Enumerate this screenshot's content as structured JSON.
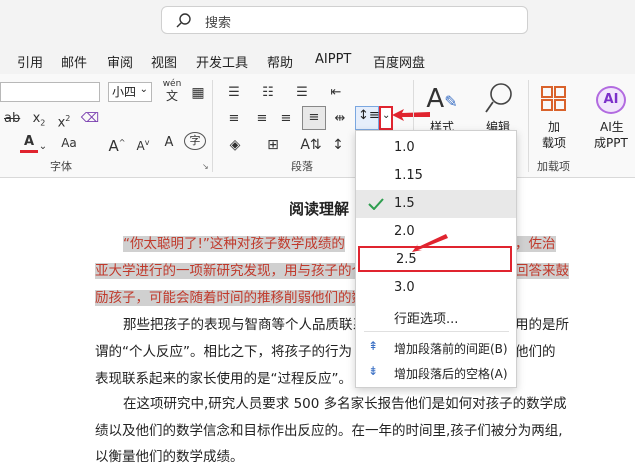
{
  "search": {
    "placeholder": "搜索"
  },
  "menu": [
    "引用",
    "邮件",
    "审阅",
    "视图",
    "开发工具",
    "帮助",
    "AIPPT",
    "百度网盘"
  ],
  "ribbon": {
    "font_size_value": "小四",
    "groups": {
      "font": "字体",
      "paragraph": "段落",
      "addin": "加载项"
    },
    "style_label": "样式",
    "edit_label": "编辑",
    "addin_label_line1": "加",
    "addin_label_line2": "载项",
    "ai_label_line1": "AI生",
    "ai_label_line2": "成PPT",
    "wen_label_top": "wén",
    "wen_label_bottom": "文"
  },
  "spacing_menu": {
    "options": [
      "1.0",
      "1.15",
      "1.5",
      "2.0",
      "2.5",
      "3.0"
    ],
    "selected": "1.5",
    "highlighted": "2.5",
    "line_options": "行距选项...",
    "add_before": "增加段落前的间距(B)",
    "add_after": "增加段落后的空格(A)"
  },
  "document": {
    "title": "阅读理解",
    "p1_l1_hl": "“你太聪明了!”这种对孩子数学成绩的",
    "p1_l1_tail": "，佐治",
    "p1_l2_hl": "亚大学进行的一项新研究发现，用与孩子的个",
    "p1_l2_tail": "回答来鼓",
    "p1_l3_hl": "励孩子，可能会随着时间的推移削弱他们的数",
    "p2_l1": "那些把孩子的表现与智商等个人品质联系",
    "p2_l1_tail": "用的是所",
    "p2_l2": "谓的“个人反应”。相比之下，将孩子的行为",
    "p2_l2_tail": "他们的",
    "p2_l3": "表现联系起来的家长使用的是“过程反应”。",
    "p3_l1": "在这项研究中,研究人员要求 500 多名家长报告他们是如何对孩子的数学成",
    "p3_l2": "绩以及他们的数学信念和目标作出反应的。在一年的时间里,孩子们被分为两组,",
    "p3_l3": "以衡量他们的数学成绩。"
  },
  "colors": {
    "accent_red": "#e0242f",
    "highlight_text": "#c0392b",
    "check_green": "#2e9e4f"
  }
}
